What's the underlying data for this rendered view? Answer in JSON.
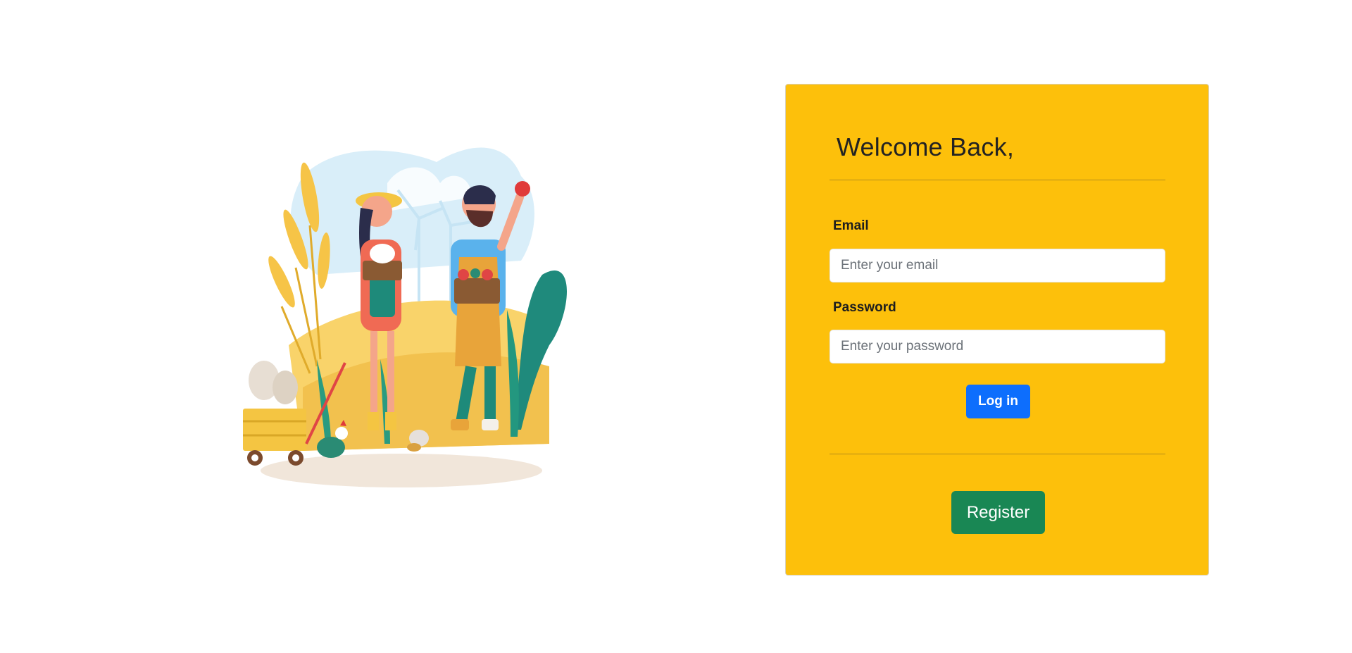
{
  "illustration": {
    "icon": "farmers-illustration"
  },
  "login": {
    "title": "Welcome Back,",
    "email_label": "Email",
    "email_placeholder": "Enter your email",
    "email_value": "",
    "password_label": "Password",
    "password_placeholder": "Enter your password",
    "password_value": "",
    "login_button": "Log in",
    "register_button": "Register"
  },
  "colors": {
    "card_background": "#fdc00b",
    "login_button": "#0d6efd",
    "register_button": "#198754"
  }
}
